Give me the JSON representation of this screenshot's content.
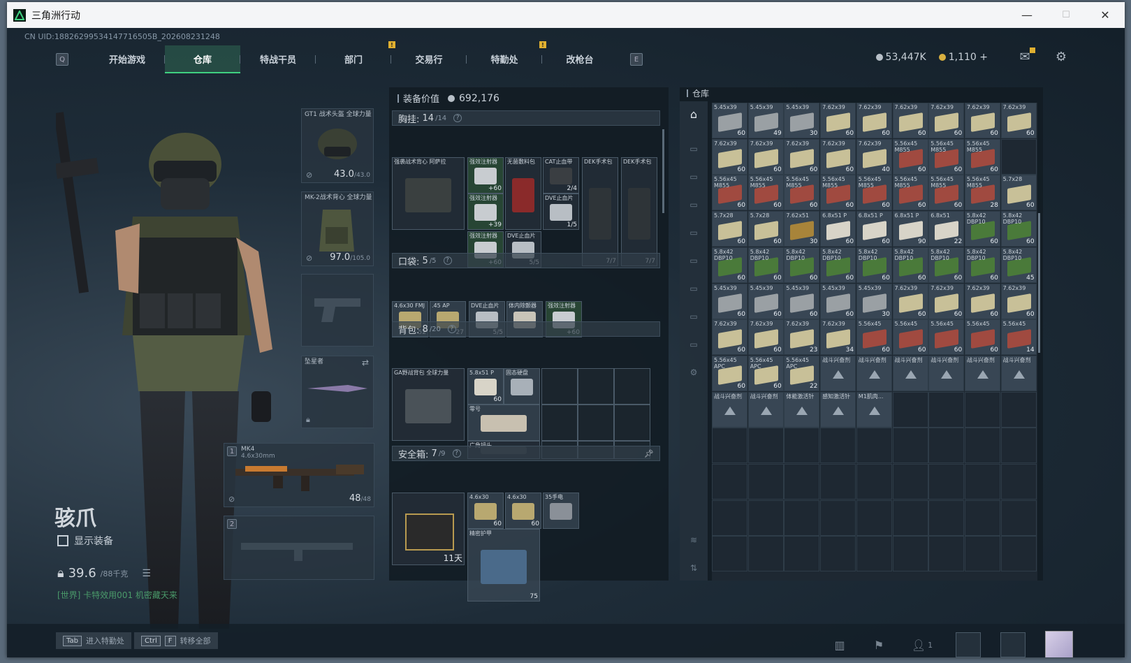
{
  "window": {
    "title": "三角洲行动",
    "min": "—",
    "max": "☐",
    "close": "✕"
  },
  "uid": "CN UID:18826299534147716505B_202608231248",
  "nav": {
    "key_left": "Q",
    "key_right": "E",
    "tabs": [
      {
        "label": "开始游戏",
        "active": false,
        "alert": false
      },
      {
        "label": "仓库",
        "active": true,
        "alert": false
      },
      {
        "label": "特战干员",
        "active": false,
        "alert": false
      },
      {
        "label": "部门",
        "active": false,
        "alert": true
      },
      {
        "label": "交易行",
        "active": false,
        "alert": false
      },
      {
        "label": "特勤处",
        "active": false,
        "alert": true
      },
      {
        "label": "改枪台",
        "active": false,
        "alert": false
      }
    ],
    "alert_mark": "!"
  },
  "currency": {
    "primary": "53,447K",
    "secondary": "1,110",
    "add": "+"
  },
  "character": {
    "name": "骇爪",
    "show_equipment": "显示装备",
    "weight": "39.6",
    "weight_max": "/88千克",
    "chat": "[世界] 卡特效用001  机密藏天来"
  },
  "equipment": {
    "helmet": {
      "label": "GT1 战术头盔 全球力量",
      "value": "43.0",
      "max": "/43.0"
    },
    "armor": {
      "label": "MK-2战术背心 全球力量",
      "value": "97.0",
      "max": "/105.0"
    },
    "melee": {
      "label": "坠星者"
    },
    "primary": {
      "slot": "1",
      "label": "MK4",
      "sub": "4.6x30mm",
      "ammo": "48",
      "ammo_max": "/48"
    },
    "secondary": {
      "slot": "2"
    }
  },
  "loadout": {
    "title": "装备价值",
    "value": "692,176",
    "chest": {
      "label": "胸挂:",
      "count": "14",
      "max": "/14"
    },
    "pocket": {
      "label": "口袋:",
      "count": "5",
      "max": "/5"
    },
    "backpack": {
      "label": "背包:",
      "count": "8",
      "max": "/20"
    },
    "safebox": {
      "label": "安全箱:",
      "count": "7",
      "max": "/9",
      "days": "11天"
    },
    "help": "?",
    "chest_items": [
      {
        "name": "强袭战术背心 阿萨拉",
        "count": ""
      },
      {
        "name": "强效注射器",
        "count": "+60"
      },
      {
        "name": "无菌敷料包",
        "count": ""
      },
      {
        "name": "CAT止血带",
        "count": "2/4"
      },
      {
        "name": "DEK手术包",
        "count": "7/7"
      },
      {
        "name": "DEK手术包",
        "count": "7/7"
      },
      {
        "name": "强效注射器",
        "count": "+39"
      },
      {
        "name": "DVE止血片",
        "count": "1/5"
      },
      {
        "name": "强效注射器",
        "count": "+60"
      },
      {
        "name": "DVE止血片",
        "count": "5/5"
      }
    ],
    "pocket_items": [
      {
        "name": "4.6x30 FMJ",
        "count": "52"
      },
      {
        "name": ".45 AP",
        "count": "27"
      },
      {
        "name": "DVE止血片",
        "count": "5/5"
      },
      {
        "name": "体内除颤器",
        "count": ""
      },
      {
        "name": "强效注射器",
        "count": "+60"
      }
    ],
    "backpack_items": [
      {
        "name": "GA野战背包 全球力量",
        "count": ""
      },
      {
        "name": "5.8x51 P",
        "count": "60"
      },
      {
        "name": "固态硬盘",
        "count": ""
      },
      {
        "name": "零号",
        "count": ""
      },
      {
        "name": "广角镜头",
        "count": ""
      }
    ],
    "safebox_items": [
      {
        "name": "4.6x30",
        "count": "60"
      },
      {
        "name": "4.6x30",
        "count": "60"
      },
      {
        "name": "35手电",
        "count": ""
      },
      {
        "name": "精密护甲",
        "count": "75"
      }
    ]
  },
  "storage": {
    "title": "仓库",
    "rows": [
      [
        [
          "5.45x39",
          "60"
        ],
        [
          "5.45x39",
          "49"
        ],
        [
          "5.45x39",
          "30"
        ],
        [
          "7.62x39",
          "60"
        ],
        [
          "7.62x39",
          "60"
        ],
        [
          "7.62x39",
          "60"
        ],
        [
          "7.62x39",
          "60"
        ],
        [
          "7.62x39",
          "60"
        ],
        [
          "7.62x39",
          "60"
        ]
      ],
      [
        [
          "7.62x39",
          "60"
        ],
        [
          "7.62x39",
          "60"
        ],
        [
          "7.62x39",
          "60"
        ],
        [
          "7.62x39",
          "60"
        ],
        [
          "7.62x39",
          "40"
        ],
        [
          "5.56x45 M855",
          "60"
        ],
        [
          "5.56x45 M855",
          "60"
        ],
        [
          "5.56x45 M855",
          "60"
        ],
        [
          "",
          ""
        ]
      ],
      [
        [
          "5.56x45 M855",
          "60"
        ],
        [
          "5.56x45 M855",
          "60"
        ],
        [
          "5.56x45 M855",
          "60"
        ],
        [
          "5.56x45 M855",
          "60"
        ],
        [
          "5.56x45 M855",
          "60"
        ],
        [
          "5.56x45 M855",
          "60"
        ],
        [
          "5.56x45 M855",
          "60"
        ],
        [
          "5.56x45 M855",
          "28"
        ],
        [
          "5.7x28",
          "60"
        ]
      ],
      [
        [
          "5.7x28",
          "60"
        ],
        [
          "5.7x28",
          "60"
        ],
        [
          "7.62x51",
          "30"
        ],
        [
          "6.8x51 P",
          "60"
        ],
        [
          "6.8x51 P",
          "60"
        ],
        [
          "6.8x51 P",
          "90"
        ],
        [
          "6.8x51",
          "22"
        ],
        [
          "5.8x42 DBP10",
          "60"
        ],
        [
          "5.8x42 DBP10",
          "60"
        ]
      ],
      [
        [
          "5.8x42 DBP10",
          "60"
        ],
        [
          "5.8x42 DBP10",
          "60"
        ],
        [
          "5.8x42 DBP10",
          "60"
        ],
        [
          "5.8x42 DBP10",
          "60"
        ],
        [
          "5.8x42 DBP10",
          "60"
        ],
        [
          "5.8x42 DBP10",
          "60"
        ],
        [
          "5.8x42 DBP10",
          "60"
        ],
        [
          "5.8x42 DBP10",
          "60"
        ],
        [
          "5.8x42 DBP10",
          "45"
        ]
      ],
      [
        [
          "5.45x39",
          "60"
        ],
        [
          "5.45x39",
          "60"
        ],
        [
          "5.45x39",
          "60"
        ],
        [
          "5.45x39",
          "60"
        ],
        [
          "5.45x39",
          "30"
        ],
        [
          "7.62x39",
          "60"
        ],
        [
          "7.62x39",
          "60"
        ],
        [
          "7.62x39",
          "60"
        ],
        [
          "7.62x39",
          "60"
        ]
      ],
      [
        [
          "7.62x39",
          "60"
        ],
        [
          "7.62x39",
          "60"
        ],
        [
          "7.62x39",
          "23"
        ],
        [
          "7.62x39",
          "34"
        ],
        [
          "5.56x45",
          "60"
        ],
        [
          "5.56x45",
          "60"
        ],
        [
          "5.56x45",
          "60"
        ],
        [
          "5.56x45",
          "60"
        ],
        [
          "5.56x45",
          "14"
        ]
      ],
      [
        [
          "5.56x45 APC",
          "60"
        ],
        [
          "5.56x45 APC",
          "60"
        ],
        [
          "5.56x45 APC",
          "22"
        ],
        [
          "战斗兴奋剂",
          ""
        ],
        [
          "战斗兴奋剂",
          ""
        ],
        [
          "战斗兴奋剂",
          ""
        ],
        [
          "战斗兴奋剂",
          ""
        ],
        [
          "战斗兴奋剂",
          ""
        ],
        [
          "战斗兴奋剂",
          ""
        ]
      ],
      [
        [
          "战斗兴奋剂",
          ""
        ],
        [
          "战斗兴奋剂",
          ""
        ],
        [
          "体能激活针",
          ""
        ],
        [
          "感知激活针",
          ""
        ],
        [
          "M1肌肉...",
          ""
        ],
        [
          "",
          ""
        ],
        [
          "",
          ""
        ],
        [
          "",
          ""
        ],
        [
          "",
          ""
        ]
      ]
    ]
  },
  "bottom": {
    "hint1_key": "Tab",
    "hint1": "进入特勤处",
    "hint2_key1": "Ctrl",
    "hint2_key2": "F",
    "hint2": "转移全部",
    "squad_count": "1"
  },
  "colors": {
    "accent": "#3fd080",
    "alert": "#e0b030"
  }
}
